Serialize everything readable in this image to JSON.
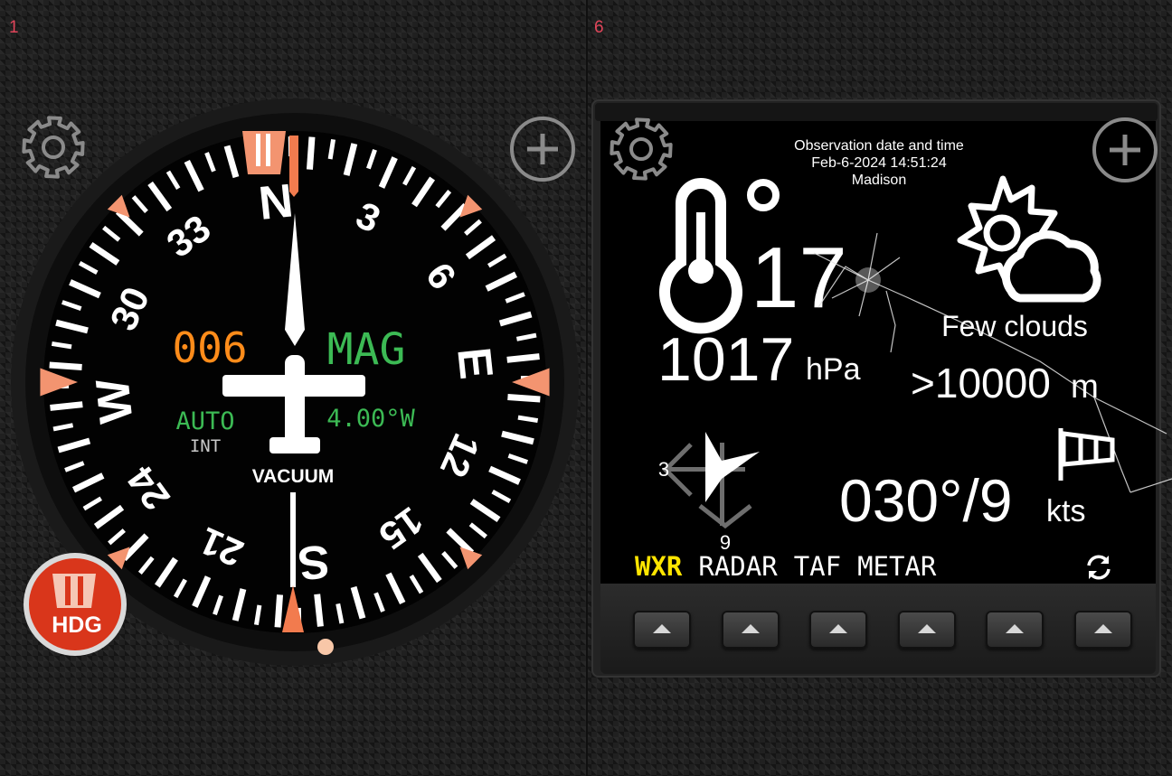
{
  "left_panel": {
    "panel_number": "1",
    "heading_readout": "006",
    "reference_mode": "MAG",
    "sync_mode": "AUTO",
    "sync_source": "INT",
    "variation": "4.00°W",
    "power_source": "VACUUM",
    "hdg_button_label": "HDG",
    "heading_deg": 6,
    "compass_labels": [
      "N",
      "3",
      "6",
      "E",
      "12",
      "15",
      "S",
      "21",
      "24",
      "W",
      "30",
      "33"
    ],
    "colors": {
      "heading_readout": "#ff8c1a",
      "mode_text": "#3cba54",
      "bug": "#f39470",
      "hdg_button": "#d9361b"
    }
  },
  "right_panel": {
    "panel_number": "6",
    "observation_label": "Observation date and time",
    "observation_datetime": "Feb-6-2024 14:51:24",
    "station": "Madison",
    "temperature": "17",
    "temperature_unit": "°",
    "pressure_value": "1017",
    "pressure_unit": "hPa",
    "sky_condition": "Few clouds",
    "visibility_value": ">10000",
    "visibility_unit": "m",
    "wind_label_left": "3",
    "wind_label_bottom": "9",
    "wind_value": "030°/9",
    "wind_unit": "kts",
    "tabs": [
      {
        "label": "WXR",
        "active": true
      },
      {
        "label": "RADAR",
        "active": false
      },
      {
        "label": "TAF",
        "active": false
      },
      {
        "label": "METAR",
        "active": false
      }
    ],
    "softkey_count": 6,
    "colors": {
      "active_tab": "#ffe500",
      "text": "#ffffff"
    }
  }
}
